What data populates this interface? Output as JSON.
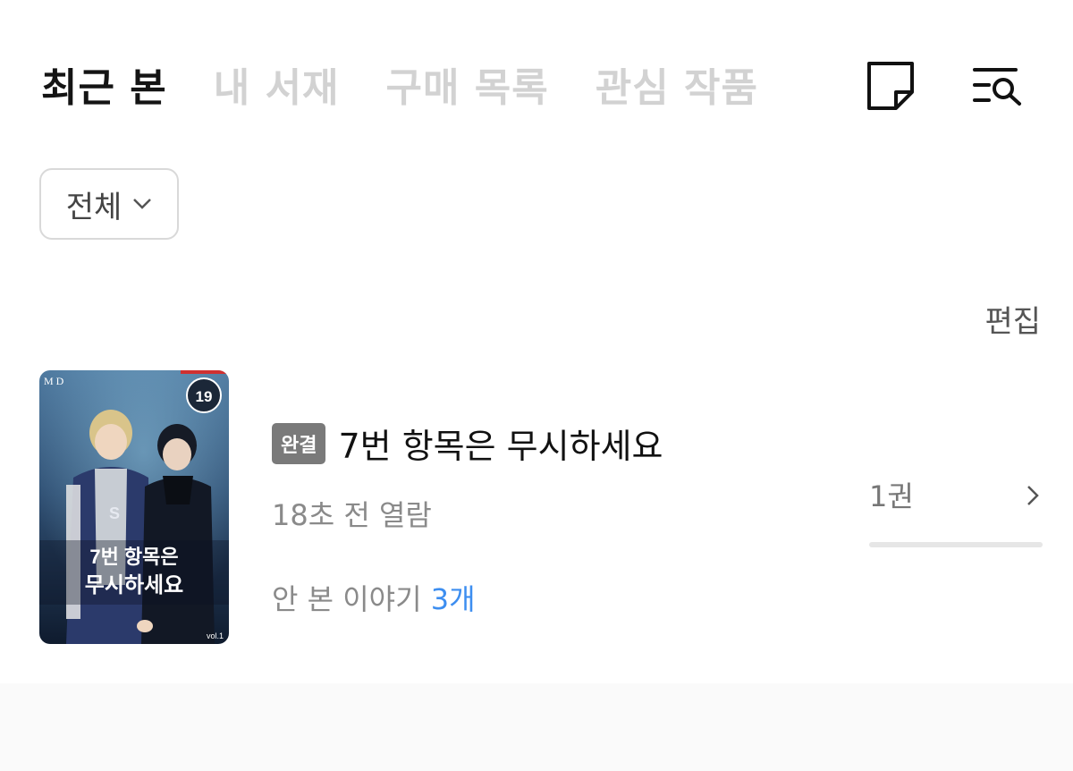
{
  "tabs": [
    {
      "label": "최근 본",
      "active": true
    },
    {
      "label": "내 서재",
      "active": false
    },
    {
      "label": "구매 목록",
      "active": false
    },
    {
      "label": "관심 작품",
      "active": false
    }
  ],
  "icons": {
    "memo": "memo-icon",
    "search_list": "list-search-icon"
  },
  "filter": {
    "label": "전체"
  },
  "edit_label": "편집",
  "items": [
    {
      "badge": "완결",
      "title": "7번 항목은 무시하세요",
      "viewed": "18초 전 열람",
      "unread_label": "안 본 이야기",
      "unread_count": "3개",
      "volume": "1권",
      "progress": 0.0,
      "cover": {
        "age_rating": "19",
        "title_line1": "7번 항목은",
        "title_line2": "무시하세요",
        "publisher_mark": "M D",
        "volume_mark": "vol.1"
      }
    }
  ],
  "colors": {
    "active_tab": "#141414",
    "inactive_tab": "#d2d2d2",
    "accent": "#3d8ef0",
    "badge_bg": "#7a7a7a"
  }
}
